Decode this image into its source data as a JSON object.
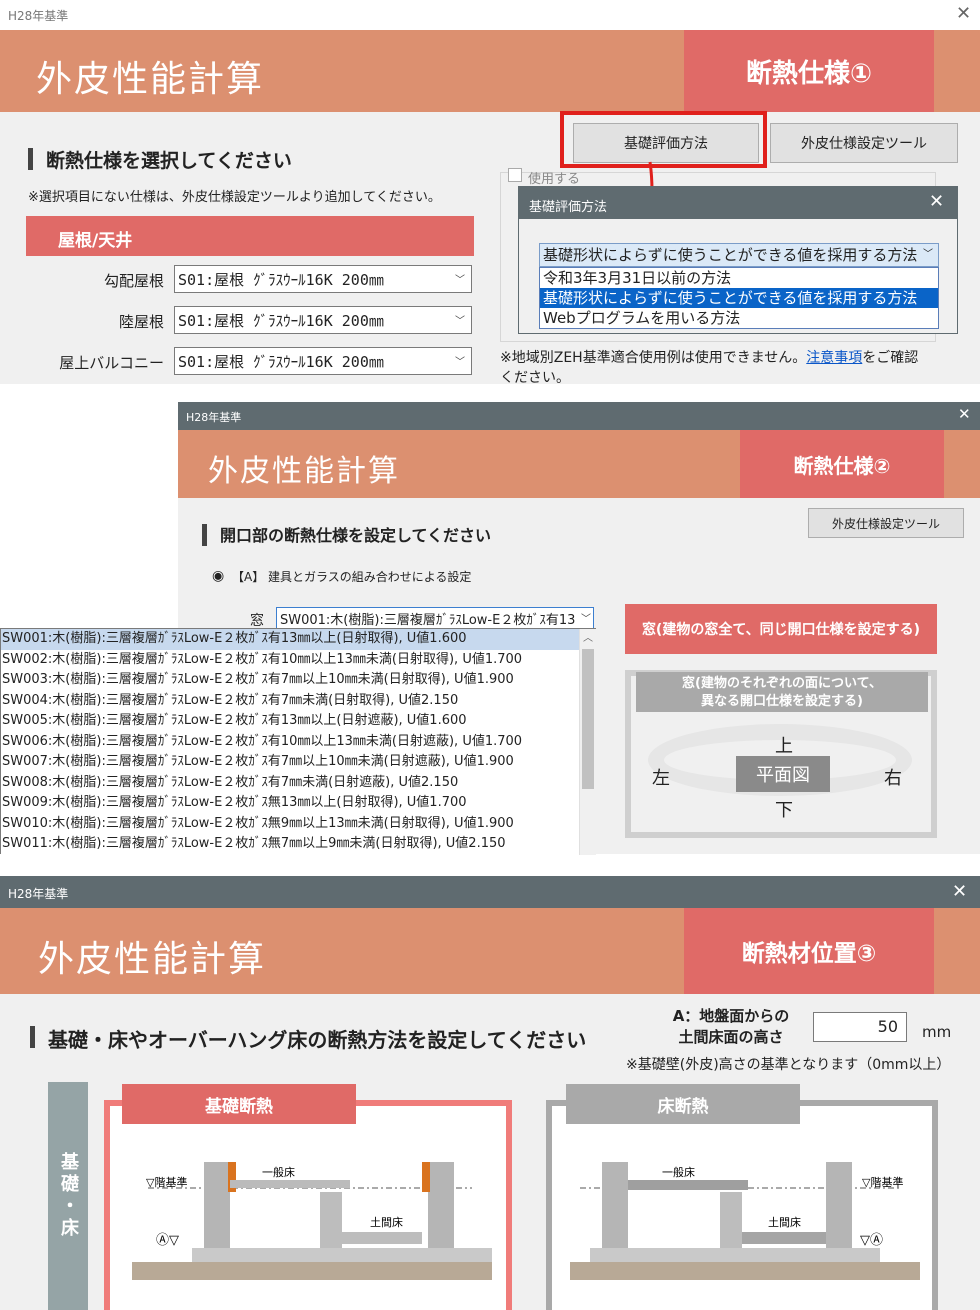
{
  "win1": {
    "window_title": "H28年基準",
    "app_title": "外皮性能計算",
    "badge": "断熱仕様①",
    "heading": "断熱仕様を選択してください",
    "note": "※選択項目にない仕様は、外皮仕様設定ツールより追加してください。",
    "section": "屋根/天井",
    "rows": [
      {
        "label": "勾配屋根",
        "value": "S01:屋根 ｸﾞﾗｽｳｰﾙ16K 200㎜"
      },
      {
        "label": "陸屋根",
        "value": "S01:屋根 ｸﾞﾗｽｳｰﾙ16K 200㎜"
      },
      {
        "label": "屋上バルコニー",
        "value": "S01:屋根 ｸﾞﾗｽｳｰﾙ16K 200㎜"
      }
    ],
    "btn_kiso": "基礎評価方法",
    "btn_tool": "外皮仕様設定ツール",
    "use_checkbox": "使用する",
    "zeh_note_1": "※地域別ZEH基準適合使用例は使用できません。",
    "zeh_link": "注意事項",
    "zeh_note_2": "をご確認",
    "zeh_note_3": "ください。",
    "dialog": {
      "title": "基礎評価方法",
      "selected": "基礎形状によらずに使うことができる値を採用する方法",
      "options": [
        "令和3年3月31日以前の方法",
        "基礎形状によらずに使うことができる値を採用する方法",
        "Webプログラムを用いる方法"
      ]
    },
    "colors": {
      "highlight": "#e0201c",
      "selection": "#0a64c8"
    }
  },
  "win2": {
    "window_title": "H28年基準",
    "app_title": "外皮性能計算",
    "badge": "断熱仕様②",
    "heading": "開口部の断熱仕様を設定してください",
    "btn_tool": "外皮仕様設定ツール",
    "radio_label": "【A】 建具とガラスの組み合わせによる設定",
    "window_label": "窓",
    "window_value": "SW001:木(樹脂):三層複層ｶﾞﾗｽLow-E２枚ｶﾞｽ有13",
    "btn_all": "窓(建物の窓全て、同じ開口仕様を設定する)",
    "each_title_1": "窓(建物のそれぞれの面について、",
    "each_title_2": "異なる開口仕様を設定する)",
    "plan": {
      "center": "平面図",
      "top": "上",
      "bottom": "下",
      "left": "左",
      "right": "右"
    },
    "list": [
      "SW001:木(樹脂):三層複層ｶﾞﾗｽLow-E２枚ｶﾞｽ有13㎜以上(日射取得), U値1.600",
      "SW002:木(樹脂):三層複層ｶﾞﾗｽLow-E２枚ｶﾞｽ有10㎜以上13㎜未満(日射取得), U値1.700",
      "SW003:木(樹脂):三層複層ｶﾞﾗｽLow-E２枚ｶﾞｽ有7㎜以上10㎜未満(日射取得), U値1.900",
      "SW004:木(樹脂):三層複層ｶﾞﾗｽLow-E２枚ｶﾞｽ有7㎜未満(日射取得), U値2.150",
      "SW005:木(樹脂):三層複層ｶﾞﾗｽLow-E２枚ｶﾞｽ有13㎜以上(日射遮蔽), U値1.600",
      "SW006:木(樹脂):三層複層ｶﾞﾗｽLow-E２枚ｶﾞｽ有10㎜以上13㎜未満(日射遮蔽), U値1.700",
      "SW007:木(樹脂):三層複層ｶﾞﾗｽLow-E２枚ｶﾞｽ有7㎜以上10㎜未満(日射遮蔽), U値1.900",
      "SW008:木(樹脂):三層複層ｶﾞﾗｽLow-E２枚ｶﾞｽ有7㎜未満(日射遮蔽), U値2.150",
      "SW009:木(樹脂):三層複層ｶﾞﾗｽLow-E２枚ｶﾞｽ無13㎜以上(日射取得), U値1.700",
      "SW010:木(樹脂):三層複層ｶﾞﾗｽLow-E２枚ｶﾞｽ無9㎜以上13㎜未満(日射取得), U値1.900",
      "SW011:木(樹脂):三層複層ｶﾞﾗｽLow-E２枚ｶﾞｽ無7㎜以上9㎜未満(日射取得), U値2.150"
    ]
  },
  "win3": {
    "window_title": "H28年基準",
    "app_title": "外皮性能計算",
    "badge": "断熱材位置③",
    "heading": "基礎・床やオーバーハング床の断熱方法を設定してください",
    "a_label_1": "A：地盤面からの",
    "a_label_2": "土間床面の高さ",
    "a_value": "50",
    "a_unit": "mm",
    "a_note": "※基礎壁(外皮)高さの基準となります（0mm以上）",
    "side_label": "基礎・床",
    "card1": {
      "title": "基礎断熱",
      "floor": "▽階基準",
      "general": "一般床",
      "doma": "土間床",
      "mark": "Ⓐ▽"
    },
    "card2": {
      "title": "床断熱",
      "floor": "▽階基準",
      "general": "一般床",
      "doma": "土間床",
      "mark": "▽Ⓐ"
    }
  }
}
